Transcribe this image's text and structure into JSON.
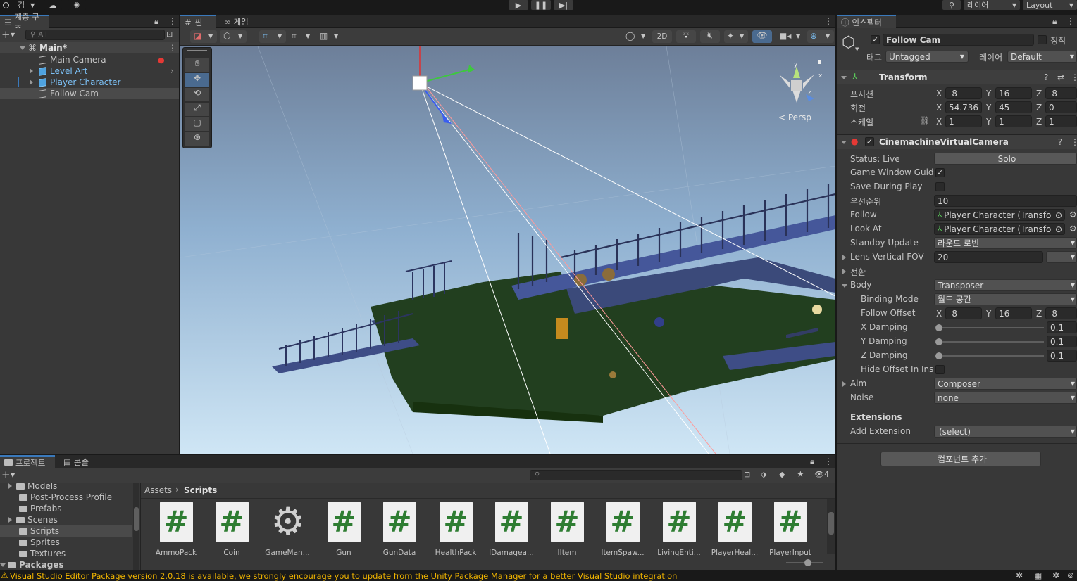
{
  "topbar": {
    "account_label": "김",
    "layers_label": "레이어",
    "layout_label": "Layout"
  },
  "hierarchy": {
    "tab_label": "계층 구조",
    "search_placeholder": "All",
    "scene_name": "Main*",
    "items": [
      {
        "label": "Main Camera"
      },
      {
        "label": "Level Art"
      },
      {
        "label": "Player Character"
      },
      {
        "label": "Follow Cam"
      }
    ]
  },
  "scene_view": {
    "tabs": [
      {
        "label": "씬"
      },
      {
        "label": "게임"
      }
    ],
    "mode_2d_label": "2D",
    "persp_label": "< Persp"
  },
  "inspector": {
    "tab_label": "인스펙터",
    "object_name": "Follow Cam",
    "static_label": "정적",
    "tag_label": "태그",
    "tag_value": "Untagged",
    "layer_label": "레이어",
    "layer_value": "Default",
    "transform": {
      "title": "Transform",
      "position_label": "포지션",
      "rotation_label": "회전",
      "scale_label": "스케일",
      "position": {
        "x": "-8",
        "y": "16",
        "z": "-8"
      },
      "rotation": {
        "x": "54.736",
        "y": "45",
        "z": "0"
      },
      "scale": {
        "x": "1",
        "y": "1",
        "z": "1"
      }
    },
    "vcam": {
      "title": "CinemachineVirtualCamera",
      "status_label": "Status: Live",
      "solo_label": "Solo",
      "game_window_guides_label": "Game Window Guid",
      "save_during_play_label": "Save During Play",
      "priority_label": "우선순위",
      "priority_value": "10",
      "follow_label": "Follow",
      "follow_value": "Player Character (Transfo",
      "look_at_label": "Look At",
      "look_at_value": "Player Character (Transfo",
      "standby_label": "Standby Update",
      "standby_value": "라운드 로빈",
      "fov_label": "Lens Vertical FOV",
      "fov_value": "20",
      "transition_label": "전환",
      "body_label": "Body",
      "body_value": "Transposer",
      "binding_mode_label": "Binding Mode",
      "binding_mode_value": "월드 공간",
      "follow_offset_label": "Follow Offset",
      "follow_offset": {
        "x": "-8",
        "y": "16",
        "z": "-8"
      },
      "x_damping_label": "X Damping",
      "x_damping_value": "0.1",
      "y_damping_label": "Y Damping",
      "y_damping_value": "0.1",
      "z_damping_label": "Z Damping",
      "z_damping_value": "0.1",
      "hide_offset_label": "Hide Offset In Ins",
      "aim_label": "Aim",
      "aim_value": "Composer",
      "noise_label": "Noise",
      "noise_value": "none",
      "extensions_label": "Extensions",
      "add_extension_label": "Add Extension",
      "add_extension_value": "(select)"
    },
    "add_component_label": "컴포넌트 추가"
  },
  "project": {
    "tabs": [
      {
        "label": "프로젝트"
      },
      {
        "label": "콘솔"
      }
    ],
    "hidden_count": "4",
    "breadcrumb_root": "Assets",
    "breadcrumb_current": "Scripts",
    "folders": [
      {
        "label": "Models"
      },
      {
        "label": "Post-Process Profile"
      },
      {
        "label": "Prefabs"
      },
      {
        "label": "Scenes"
      },
      {
        "label": "Scripts"
      },
      {
        "label": "Sprites"
      },
      {
        "label": "Textures"
      }
    ],
    "packages_label": "Packages",
    "assets": [
      {
        "name": "AmmoPack",
        "kind": "script"
      },
      {
        "name": "Coin",
        "kind": "script"
      },
      {
        "name": "GameMan...",
        "kind": "gear"
      },
      {
        "name": "Gun",
        "kind": "script"
      },
      {
        "name": "GunData",
        "kind": "script"
      },
      {
        "name": "HealthPack",
        "kind": "script"
      },
      {
        "name": "IDamagea...",
        "kind": "script"
      },
      {
        "name": "IItem",
        "kind": "script"
      },
      {
        "name": "ItemSpaw...",
        "kind": "script"
      },
      {
        "name": "LivingEnti...",
        "kind": "script"
      },
      {
        "name": "PlayerHeal...",
        "kind": "script"
      },
      {
        "name": "PlayerInput",
        "kind": "script"
      }
    ]
  },
  "status_bar": {
    "message": "Visual Studio Editor Package version 2.0.18 is available, we strongly encourage you to update from the Unity Package Manager for a better Visual Studio integration"
  },
  "colors": {
    "accent": "#3a79bb",
    "selected_text": "#7cc0f5",
    "warning": "#f0b400",
    "script_hash": "#2e7d32"
  }
}
